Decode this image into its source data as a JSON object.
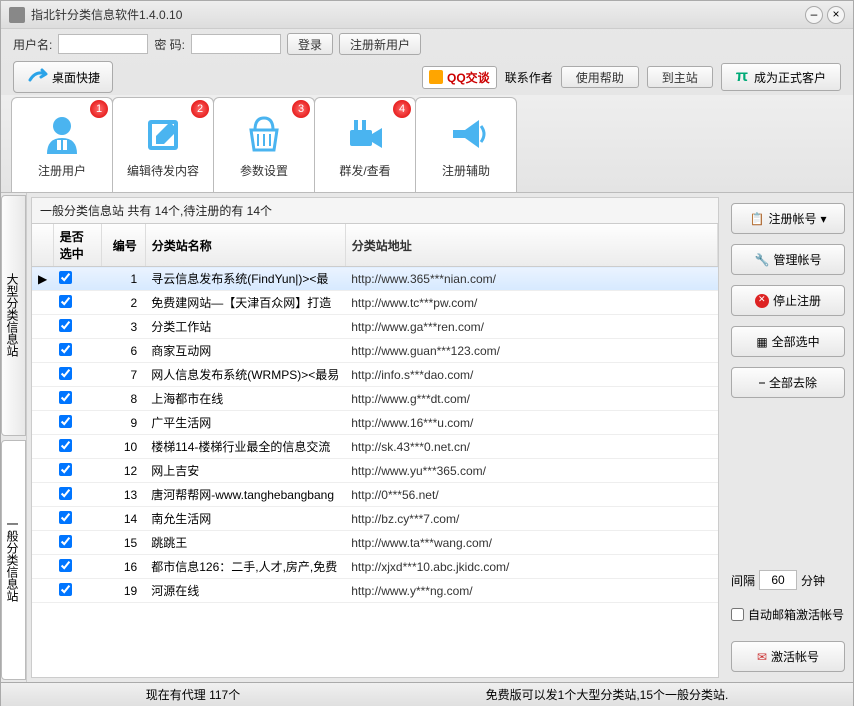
{
  "window": {
    "title": "指北针分类信息软件1.4.0.10"
  },
  "login": {
    "user_label": "用户名:",
    "pass_label": "密  码:",
    "login_btn": "登录",
    "register_btn": "注册新用户"
  },
  "toolbar": {
    "shortcut": "桌面快捷",
    "qq": "QQ交谈",
    "contact": "联系作者",
    "help": "使用帮助",
    "tosite": "到主站",
    "customer": "成为正式客户"
  },
  "tabs": [
    {
      "label": "注册用户",
      "badge": "1"
    },
    {
      "label": "编辑待发内容",
      "badge": "2"
    },
    {
      "label": "参数设置",
      "badge": "3"
    },
    {
      "label": "群发/查看",
      "badge": "4"
    },
    {
      "label": "注册辅助",
      "badge": ""
    }
  ],
  "vtabs": {
    "t1": "大型分类信息站",
    "t2": "一般分类信息站"
  },
  "table": {
    "caption": "一般分类信息站 共有 14个,待注册的有 14个",
    "headers": {
      "check": "是否选中",
      "num": "编号",
      "name": "分类站名称",
      "url": "分类站地址"
    },
    "rows": [
      {
        "n": "1",
        "name": "寻云信息发布系统(FindYun|)><最",
        "url": "http://www.365***nian.com/"
      },
      {
        "n": "2",
        "name": "免费建网站—【天津百众网】打造",
        "url": "http://www.tc***pw.com/"
      },
      {
        "n": "3",
        "name": "分类工作站",
        "url": "http://www.ga***ren.com/"
      },
      {
        "n": "6",
        "name": "商家互动网",
        "url": "http://www.guan***123.com/"
      },
      {
        "n": "7",
        "name": "网人信息发布系统(WRMPS)><最易",
        "url": "http://info.s***dao.com/"
      },
      {
        "n": "8",
        "name": "上海都市在线",
        "url": "http://www.g***dt.com/"
      },
      {
        "n": "9",
        "name": "广平生活网",
        "url": "http://www.16***u.com/"
      },
      {
        "n": "10",
        "name": "楼梯114-楼梯行业最全的信息交流",
        "url": "http://sk.43***0.net.cn/"
      },
      {
        "n": "12",
        "name": "网上吉安",
        "url": "http://www.yu***365.com/"
      },
      {
        "n": "13",
        "name": "唐河帮帮网-www.tanghebangbang",
        "url": "http://0***56.net/"
      },
      {
        "n": "14",
        "name": "南允生活网",
        "url": "http://bz.cy***7.com/"
      },
      {
        "n": "15",
        "name": "跳跳王",
        "url": "http://www.ta***wang.com/"
      },
      {
        "n": "16",
        "name": "都市信息126：二手,人才,房产,免费",
        "url": "http://xjxd***10.abc.jkidc.com/"
      },
      {
        "n": "19",
        "name": "河源在线",
        "url": "http://www.y***ng.com/"
      }
    ]
  },
  "right": {
    "register": "注册帐号",
    "manage": "管理帐号",
    "stop": "停止注册",
    "selectall": "全部选中",
    "removeall": "全部去除",
    "interval_label": "间隔",
    "interval_val": "60",
    "interval_unit": "分钟",
    "auto_chk": "自动邮箱激活帐号",
    "activate": "激活帐号"
  },
  "status": {
    "left": "现在有代理 117个",
    "right": "免费版可以发1个大型分类站,15个一般分类站."
  }
}
